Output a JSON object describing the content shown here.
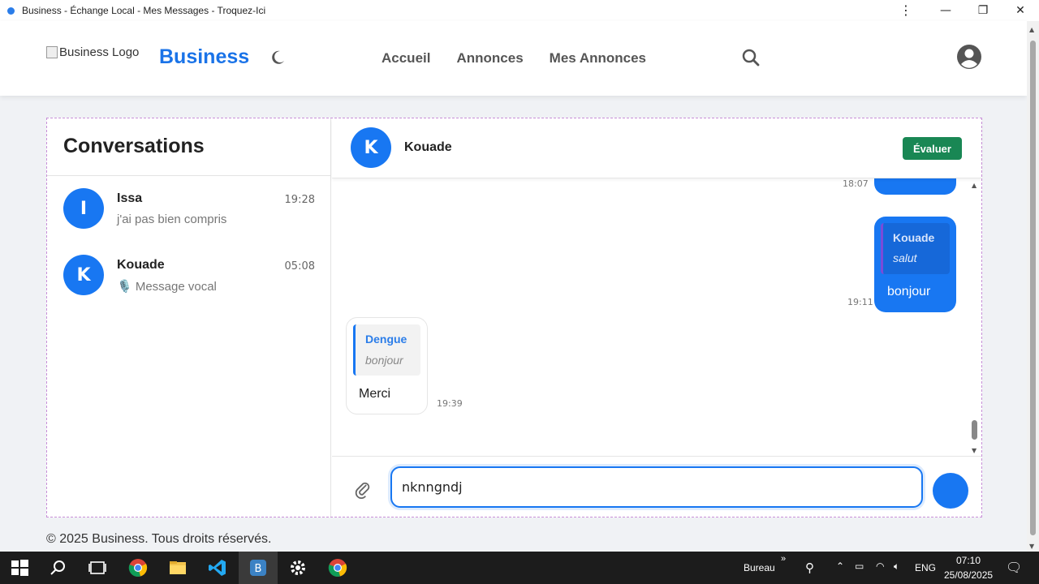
{
  "window": {
    "title": "Business - Échange Local - Mes Messages - Troquez-Ici"
  },
  "header": {
    "logo_alt": "Business Logo",
    "brand": "Business",
    "nav": [
      "Accueil",
      "Annonces",
      "Mes Annonces"
    ]
  },
  "sidebar": {
    "title": "Conversations",
    "conversations": [
      {
        "initial": "I",
        "name": "Issa",
        "time": "19:28",
        "preview": "j'ai pas bien compris"
      },
      {
        "initial": "K",
        "name": "Kouade",
        "time": "05:08",
        "preview": "🎙️ Message vocal"
      }
    ]
  },
  "chat": {
    "contact_initial": "K",
    "contact_name": "Kouade",
    "rate_label": "Évaluer",
    "messages": [
      {
        "direction": "out",
        "time": "18:07",
        "partial": true
      },
      {
        "direction": "out",
        "time": "19:11",
        "quote_name": "Kouade",
        "quote_text": "salut",
        "text": "bonjour"
      },
      {
        "direction": "in",
        "time": "19:39",
        "quote_name": "Dengue",
        "quote_text": "bonjour",
        "text": "Merci"
      }
    ],
    "input_value": "nknngndj"
  },
  "footer": {
    "text": "© 2025 Business. Tous droits réservés."
  },
  "taskbar": {
    "toolbar_label": "Bureau",
    "language": "ENG",
    "time": "07:10",
    "date": "25/08/2025"
  },
  "colors": {
    "primary": "#1877f2",
    "rate_green": "#198754",
    "brand_blue": "#1a73e8"
  }
}
